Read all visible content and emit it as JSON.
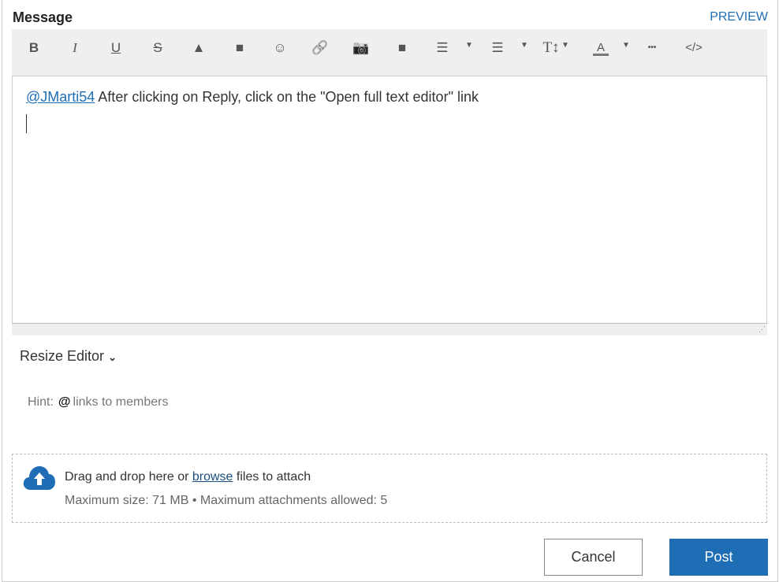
{
  "header": {
    "title": "Message",
    "preview_label": "PREVIEW"
  },
  "toolbar": {
    "items": [
      {
        "name": "bold",
        "glyph": "B"
      },
      {
        "name": "italic",
        "glyph": "I"
      },
      {
        "name": "underline",
        "glyph": "U"
      },
      {
        "name": "strikethrough",
        "glyph": "S"
      },
      {
        "name": "spoiler-warning",
        "glyph": "▲"
      },
      {
        "name": "video",
        "glyph": "■"
      },
      {
        "name": "emoji",
        "glyph": "☺"
      },
      {
        "name": "link",
        "glyph": "🔗"
      },
      {
        "name": "camera",
        "glyph": "📷"
      },
      {
        "name": "video-2",
        "glyph": "■"
      },
      {
        "name": "ordered-list",
        "glyph": "☰"
      },
      {
        "name": "bullet-list",
        "glyph": "☰"
      },
      {
        "name": "font-size",
        "glyph": "T↕"
      },
      {
        "name": "text-color",
        "glyph": "A"
      },
      {
        "name": "more",
        "glyph": "•••"
      },
      {
        "name": "source-code",
        "glyph": "</>"
      }
    ]
  },
  "editor": {
    "mention": "@JMarti54",
    "text": " After clicking on Reply, click on the \"Open full text editor\" link"
  },
  "resize_label": "Resize Editor",
  "hint": {
    "label": "Hint:",
    "symbol": "@",
    "text": "links to members"
  },
  "attach": {
    "prefix": "Drag and drop here or ",
    "browse": "browse",
    "suffix": " files to attach",
    "limits": "Maximum size: 71 MB • Maximum attachments allowed: 5"
  },
  "buttons": {
    "cancel": "Cancel",
    "post": "Post"
  },
  "colors": {
    "accent": "#1f6db5",
    "toolbar_bg": "#f0eeee"
  }
}
